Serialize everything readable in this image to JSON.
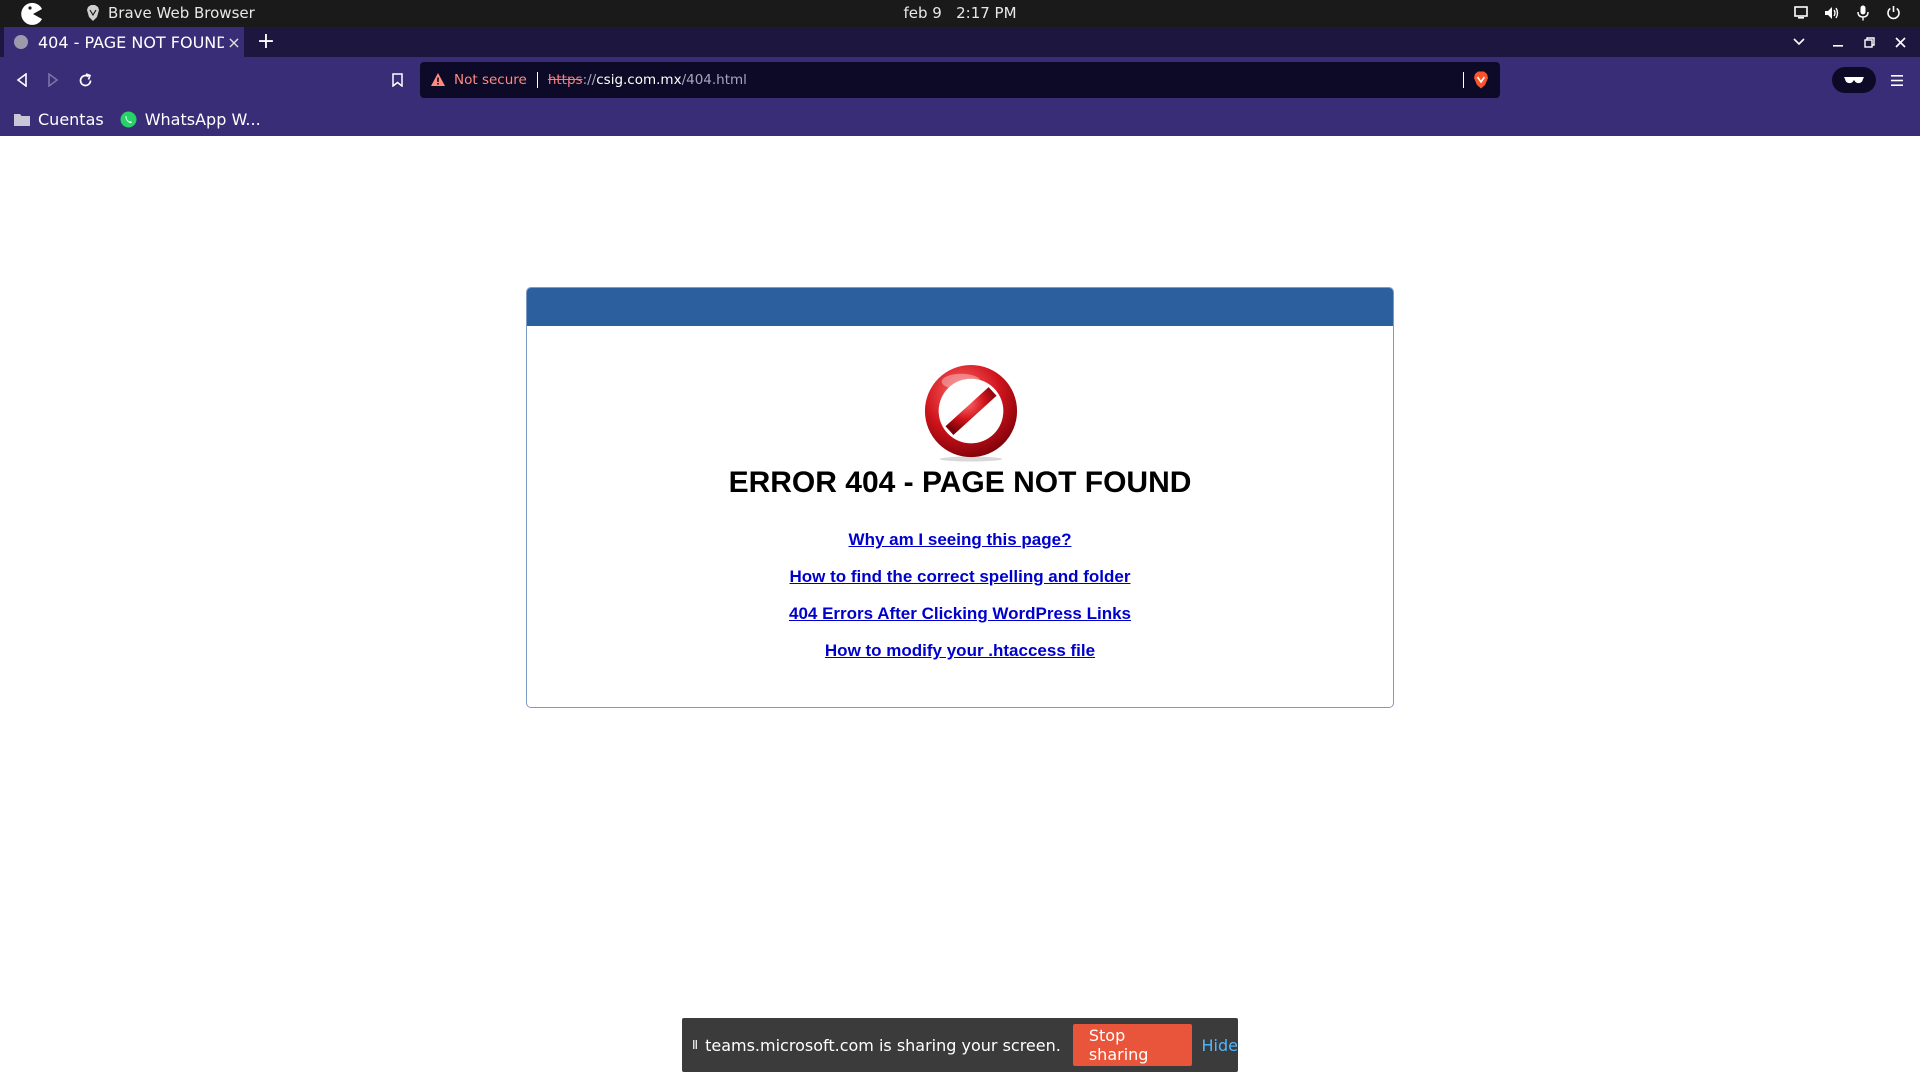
{
  "system_bar": {
    "app_name": "Brave Web Browser",
    "date": "feb 9",
    "time": "2:17 PM"
  },
  "browser": {
    "tab": {
      "title": "404 - PAGE NOT FOUND",
      "close": "×"
    },
    "new_tab": "+",
    "omnibox": {
      "security": "Not secure",
      "scheme": "https",
      "scheme_sep": "://",
      "host": "csig.com.mx",
      "path": "/404.html"
    },
    "bookmarks": [
      {
        "label": "Cuentas",
        "icon": "folder-icon"
      },
      {
        "label": "WhatsApp W...",
        "icon": "whatsapp-icon"
      }
    ],
    "colors": {
      "chrome": "#3a2d77",
      "tabstrip": "#1d1740",
      "omnibox": "#0c0a26"
    }
  },
  "page": {
    "heading": "ERROR 404 - PAGE NOT FOUND",
    "links": [
      "Why am I seeing this page?",
      "How to find the correct spelling and folder",
      "404 Errors After Clicking WordPress Links",
      "How to modify your .htaccess file"
    ],
    "colors": {
      "header": "#2c5f9e",
      "link": "#0000cc",
      "stop_icon": "#d0141c"
    }
  },
  "share_bar": {
    "pause_icon": "II",
    "message": "teams.microsoft.com is sharing your screen.",
    "stop_label": "Stop sharing",
    "hide_label": "Hide"
  }
}
